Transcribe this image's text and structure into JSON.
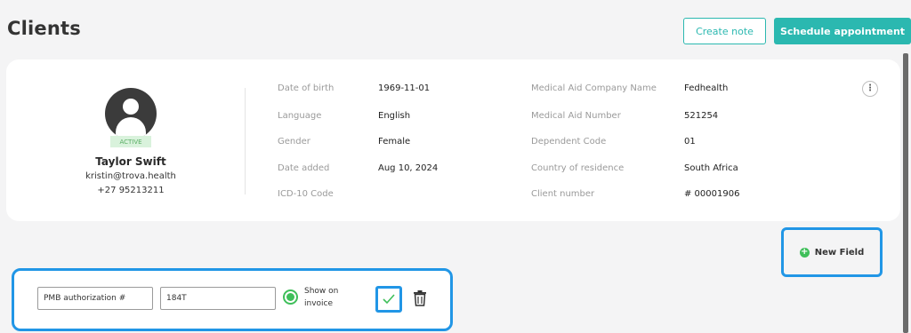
{
  "page": {
    "title": "Clients"
  },
  "header": {
    "create_note_label": "Create note",
    "schedule_label": "Schedule appointment"
  },
  "client": {
    "status": "ACTIVE",
    "name": "Taylor Swift",
    "email": "kristin@trova.health",
    "phone": "+27 95213211"
  },
  "details_left": [
    {
      "label": "Date of birth",
      "value": "1969-11-01"
    },
    {
      "label": "Language",
      "value": "English"
    },
    {
      "label": "Gender",
      "value": "Female"
    },
    {
      "label": "Date added",
      "value": "Aug 10, 2024"
    },
    {
      "label": "ICD-10 Code",
      "value": ""
    }
  ],
  "details_right": [
    {
      "label": "Medical Aid Company Name",
      "value": "Fedhealth"
    },
    {
      "label": "Medical Aid Number",
      "value": "521254"
    },
    {
      "label": "Dependent Code",
      "value": "01"
    },
    {
      "label": "Country of residence",
      "value": "South Africa"
    },
    {
      "label": "Client number",
      "value": "# 00001906"
    }
  ],
  "new_field": {
    "label": "New Field"
  },
  "custom_field": {
    "name_value": "PMB authorization #",
    "value_value": "184T",
    "show_on_invoice_label": "Show on invoice"
  },
  "colors": {
    "accent": "#2bb8b0",
    "highlight": "#2196e6",
    "success": "#3fbf5a"
  },
  "icons": [
    "more-icon",
    "plus-circle-icon",
    "check-icon",
    "trash-icon",
    "user-avatar-icon"
  ]
}
